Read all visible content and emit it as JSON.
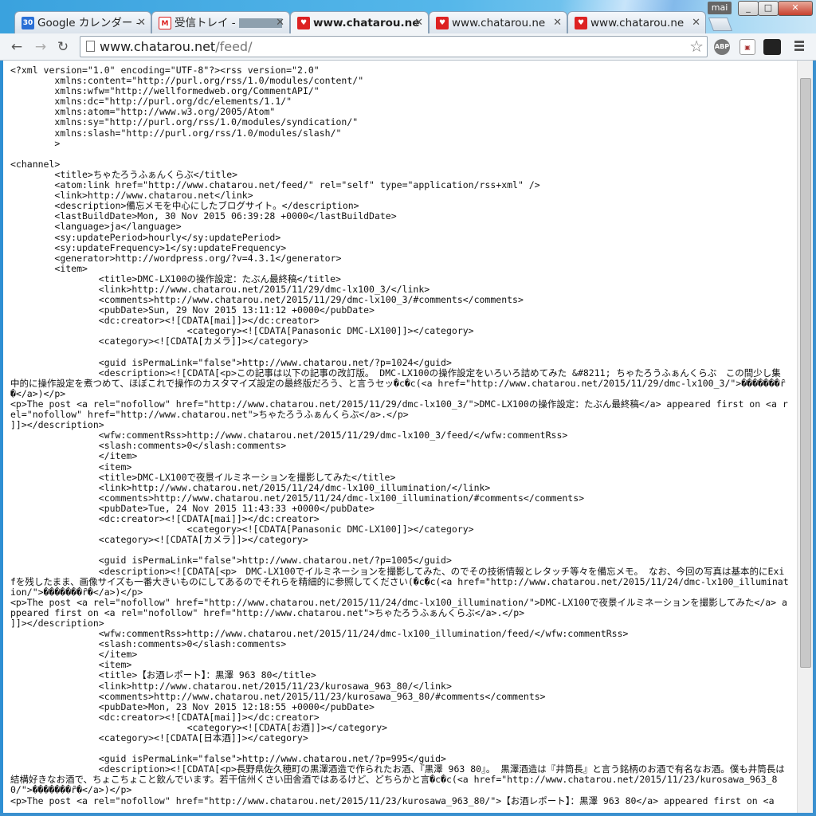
{
  "window": {
    "user": "mai",
    "min": "_",
    "max": "□",
    "close": "✕"
  },
  "tabs": [
    {
      "favicon": "30",
      "label": "Google カレンダー -",
      "close": "✕"
    },
    {
      "favicon": "M",
      "label": "受信トレイ -",
      "close": "✕"
    },
    {
      "favicon": "♥",
      "label": "www.chatarou.ne",
      "close": "✕"
    },
    {
      "favicon": "♥",
      "label": "www.chatarou.ne",
      "close": "✕"
    },
    {
      "favicon": "♥",
      "label": "www.chatarou.ne",
      "close": "✕"
    }
  ],
  "toolbar": {
    "back": "←",
    "forward": "→",
    "reload": "↻",
    "url_host": "www.chatarou.net",
    "url_path": "/feed/",
    "star": "☆",
    "extensions": [
      "ABP",
      "▣",
      "",
      ""
    ]
  },
  "icons": {
    "back": "back-arrow-icon",
    "forward": "forward-arrow-icon",
    "reload": "reload-icon",
    "page": "page-icon",
    "star": "bookmark-star-icon",
    "menu": "hamburger-menu-icon"
  },
  "colors": {
    "frame": "#2e8fd3",
    "tab_active": "#f1f4f7",
    "favicon_red": "#d22",
    "favicon_blue": "#2a6fd6"
  },
  "content": {
    "source": "<?xml version=\"1.0\" encoding=\"UTF-8\"?><rss version=\"2.0\"\n\txmlns:content=\"http://purl.org/rss/1.0/modules/content/\"\n\txmlns:wfw=\"http://wellformedweb.org/CommentAPI/\"\n\txmlns:dc=\"http://purl.org/dc/elements/1.1/\"\n\txmlns:atom=\"http://www.w3.org/2005/Atom\"\n\txmlns:sy=\"http://purl.org/rss/1.0/modules/syndication/\"\n\txmlns:slash=\"http://purl.org/rss/1.0/modules/slash/\"\n\t>\n\n<channel>\n\t<title>ちゃたろうふぁんくらぶ</title>\n\t<atom:link href=\"http://www.chatarou.net/feed/\" rel=\"self\" type=\"application/rss+xml\" />\n\t<link>http://www.chatarou.net</link>\n\t<description>備忘メモを中心にしたブログサイト。</description>\n\t<lastBuildDate>Mon, 30 Nov 2015 06:39:28 +0000</lastBuildDate>\n\t<language>ja</language>\n\t<sy:updatePeriod>hourly</sy:updatePeriod>\n\t<sy:updateFrequency>1</sy:updateFrequency>\n\t<generator>http://wordpress.org/?v=4.3.1</generator>\n\t<item>\n\t\t<title>DMC-LX100の操作設定：たぶん最終稿</title>\n\t\t<link>http://www.chatarou.net/2015/11/29/dmc-lx100_3/</link>\n\t\t<comments>http://www.chatarou.net/2015/11/29/dmc-lx100_3/#comments</comments>\n\t\t<pubDate>Sun, 29 Nov 2015 13:11:12 +0000</pubDate>\n\t\t<dc:creator><![CDATA[mai]]></dc:creator>\n\t\t\t\t<category><![CDATA[Panasonic DMC-LX100]]></category>\n\t\t<category><![CDATA[カメラ]]></category>\n\n\t\t<guid isPermaLink=\"false\">http://www.chatarou.net/?p=1024</guid>\n\t\t<description><![CDATA[<p>この記事は以下の記事の改訂版。 DMC-LX100の操作設定をいろいろ詰めてみた &#8211; ちゃたろうふぁんくらぶ　この間少し集中的に操作設定を煮つめて、ほぼこれで操作のカスタマイズ設定の最終版だろう、と言うセッ�c�c(<a href=\"http://www.chatarou.net/2015/11/29/dmc-lx100_3/\">�������ȓ�</a>)</p>\n<p>The post <a rel=\"nofollow\" href=\"http://www.chatarou.net/2015/11/29/dmc-lx100_3/\">DMC-LX100の操作設定：たぶん最終稿</a> appeared first on <a rel=\"nofollow\" href=\"http://www.chatarou.net\">ちゃたろうふぁんくらぶ</a>.</p>\n]]></description>\n\t\t<wfw:commentRss>http://www.chatarou.net/2015/11/29/dmc-lx100_3/feed/</wfw:commentRss>\n\t\t<slash:comments>0</slash:comments>\n\t\t</item>\n\t\t<item>\n\t\t<title>DMC-LX100で夜景イルミネーションを撮影してみた</title>\n\t\t<link>http://www.chatarou.net/2015/11/24/dmc-lx100_illumination/</link>\n\t\t<comments>http://www.chatarou.net/2015/11/24/dmc-lx100_illumination/#comments</comments>\n\t\t<pubDate>Tue, 24 Nov 2015 11:43:33 +0000</pubDate>\n\t\t<dc:creator><![CDATA[mai]]></dc:creator>\n\t\t\t\t<category><![CDATA[Panasonic DMC-LX100]]></category>\n\t\t<category><![CDATA[カメラ]]></category>\n\n\t\t<guid isPermaLink=\"false\">http://www.chatarou.net/?p=1005</guid>\n\t\t<description><![CDATA[<p>　DMC-LX100でイルミネーションを撮影してみた、のでその技術情報とレタッチ等々を備忘メモ。 なお、今回の写真は基本的にExifを残したまま、画像サイズも一番大きいものにしてあるのでそれらを精細的に参照してください(�c�c(<a href=\"http://www.chatarou.net/2015/11/24/dmc-lx100_illumination/\">�������ȓ�</a>)</p>\n<p>The post <a rel=\"nofollow\" href=\"http://www.chatarou.net/2015/11/24/dmc-lx100_illumination/\">DMC-LX100で夜景イルミネーションを撮影してみた</a> appeared first on <a rel=\"nofollow\" href=\"http://www.chatarou.net\">ちゃたろうふぁんくらぶ</a>.</p>\n]]></description>\n\t\t<wfw:commentRss>http://www.chatarou.net/2015/11/24/dmc-lx100_illumination/feed/</wfw:commentRss>\n\t\t<slash:comments>0</slash:comments>\n\t\t</item>\n\t\t<item>\n\t\t<title>【お酒レポート】：黒澤 963 80</title>\n\t\t<link>http://www.chatarou.net/2015/11/23/kurosawa_963_80/</link>\n\t\t<comments>http://www.chatarou.net/2015/11/23/kurosawa_963_80/#comments</comments>\n\t\t<pubDate>Mon, 23 Nov 2015 12:18:55 +0000</pubDate>\n\t\t<dc:creator><![CDATA[mai]]></dc:creator>\n\t\t\t\t<category><![CDATA[お酒]]></category>\n\t\t<category><![CDATA[日本酒]]></category>\n\n\t\t<guid isPermaLink=\"false\">http://www.chatarou.net/?p=995</guid>\n\t\t<description><![CDATA[<p>長野県佐久穂町の黒澤酒造で作られたお酒、『黒澤 963 80』。 黒澤酒造は『井筒長』と言う銘柄のお酒で有名なお酒。僕も井筒長は結構好きなお酒で、ちょこちょこと飲んでいます。若干信州くさい田舎酒ではあるけど、どちらかと言�c�c(<a href=\"http://www.chatarou.net/2015/11/23/kurosawa_963_80/\">�������ȓ�</a>)</p>\n<p>The post <a rel=\"nofollow\" href=\"http://www.chatarou.net/2015/11/23/kurosawa_963_80/\">【お酒レポート】：黒澤 963 80</a> appeared first on <a"
  }
}
